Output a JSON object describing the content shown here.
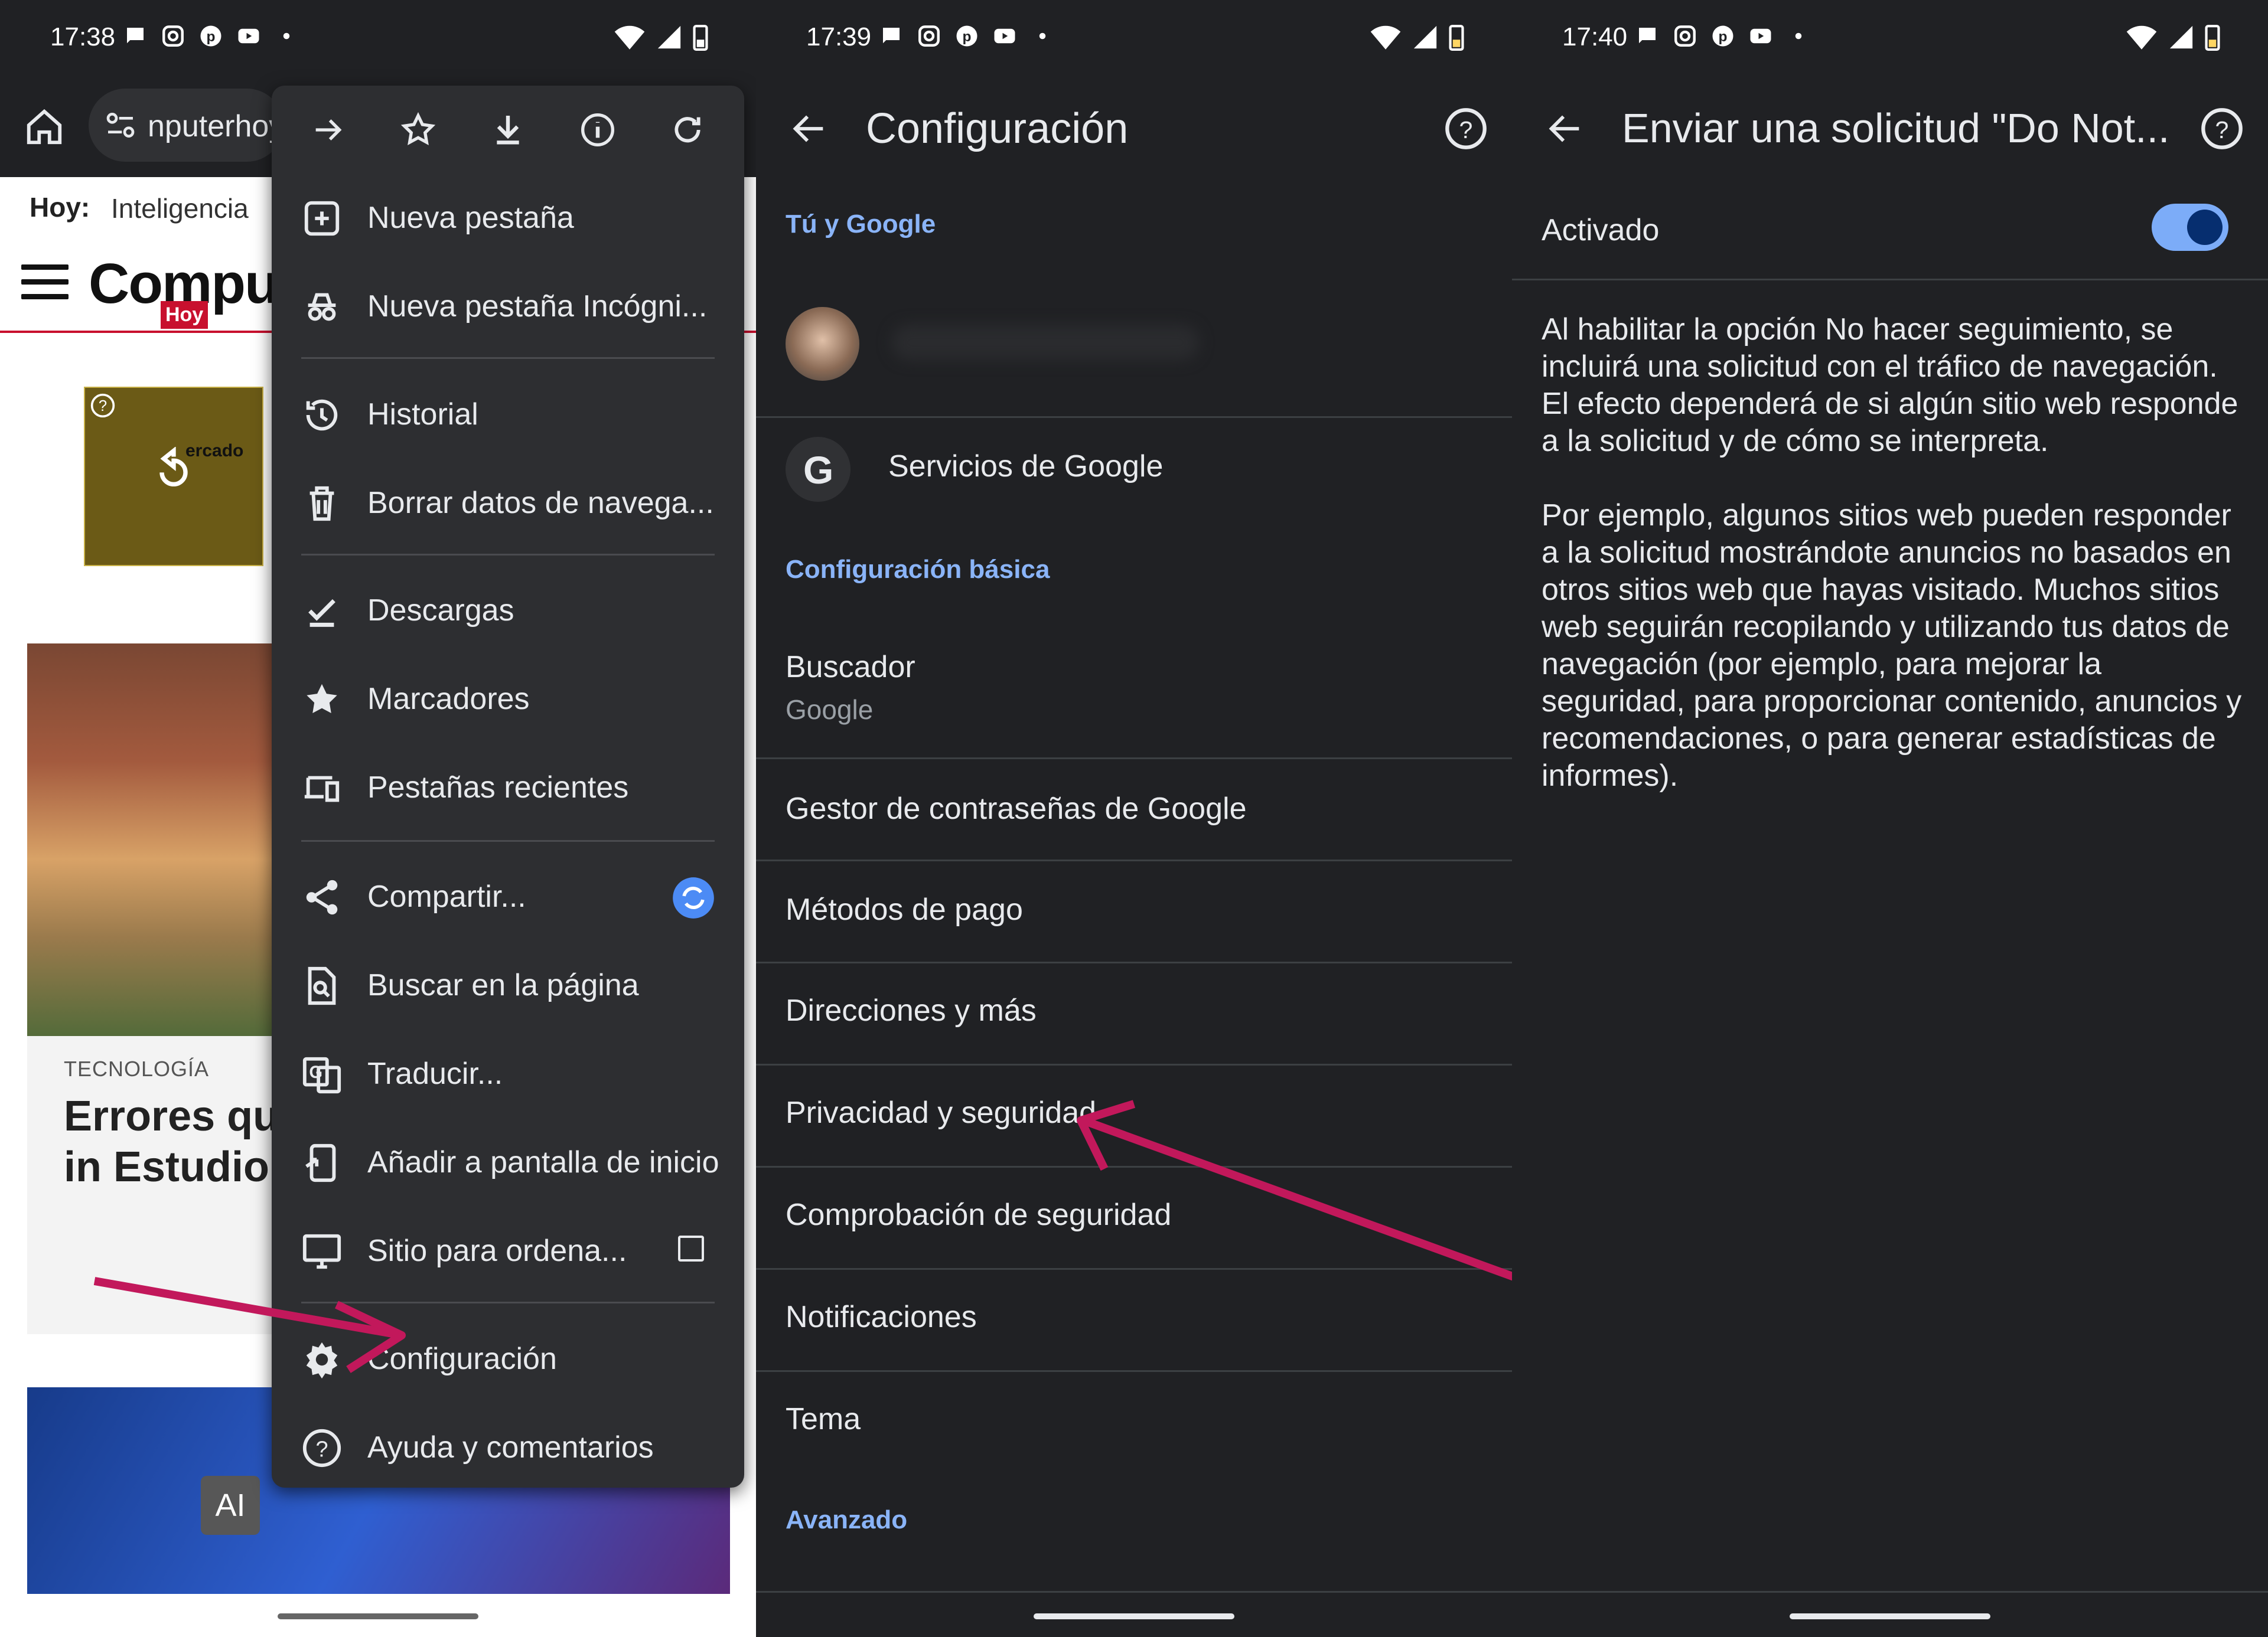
{
  "colors": {
    "background": "#202124",
    "accent_blue": "#8ab4f8",
    "arrow_magenta": "#c2185b",
    "toggle_on": "#7cacf8"
  },
  "panel1": {
    "status": {
      "time": "17:38"
    },
    "url_text": "nputerhoy",
    "ticker": {
      "label": "Hoy:",
      "text": "Inteligencia"
    },
    "logo": {
      "main": "Comput",
      "sub": "Hoy"
    },
    "ad": {
      "text": "ercado"
    },
    "article": {
      "kicker": "TECNOLOGÍA",
      "headline": "Errores qu ChatGPT p mejores in Estudio Gl"
    },
    "ai_badge": "AI",
    "menu": {
      "top_icons": [
        "forward-icon",
        "star-icon",
        "download-icon",
        "info-icon",
        "refresh-icon"
      ],
      "items": [
        {
          "label": "Nueva pestaña",
          "icon": "new-tab-icon"
        },
        {
          "label": "Nueva pestaña Incógni...",
          "icon": "incognito-icon"
        },
        {
          "label": "Historial",
          "icon": "history-icon"
        },
        {
          "label": "Borrar datos de navega...",
          "icon": "trash-icon"
        },
        {
          "label": "Descargas",
          "icon": "downloads-icon"
        },
        {
          "label": "Marcadores",
          "icon": "star-icon"
        },
        {
          "label": "Pestañas recientes",
          "icon": "devices-icon"
        },
        {
          "label": "Compartir...",
          "icon": "share-icon"
        },
        {
          "label": "Buscar en la página",
          "icon": "find-in-page-icon"
        },
        {
          "label": "Traducir...",
          "icon": "translate-icon"
        },
        {
          "label": "Añadir a pantalla de inicio",
          "icon": "add-to-home-icon"
        },
        {
          "label": "Sitio para ordena...",
          "icon": "desktop-icon"
        },
        {
          "label": "Configuración",
          "icon": "gear-icon"
        },
        {
          "label": "Ayuda y comentarios",
          "icon": "help-icon"
        }
      ]
    }
  },
  "panel2": {
    "status": {
      "time": "17:39"
    },
    "title": "Configuración",
    "sections": {
      "you_google": "Tú y Google",
      "basic": "Configuración básica",
      "advanced": "Avanzado"
    },
    "google_services": "Servicios de Google",
    "search_engine": {
      "label": "Buscador",
      "value": "Google"
    },
    "rows": [
      "Gestor de contraseñas de Google",
      "Métodos de pago",
      "Direcciones y más",
      "Privacidad y seguridad",
      "Comprobación de seguridad",
      "Notificaciones",
      "Tema"
    ]
  },
  "panel3": {
    "status": {
      "time": "17:40"
    },
    "title": "Enviar una solicitud \"Do Not...",
    "toggle_label": "Activado",
    "toggle_on": true,
    "paragraph1": "Al habilitar la opción No hacer seguimiento, se incluirá una solicitud con el tráfico de navegación. El efecto dependerá de si algún sitio web responde a la solicitud y de cómo se interpreta.",
    "paragraph2": "Por ejemplo, algunos sitios web pueden responder a la solicitud mostrándote anuncios no basados en otros sitios web que hayas visitado. Muchos sitios web seguirán recopilando y utilizando tus datos de navegación (por ejemplo, para mejorar la seguridad, para proporcionar contenido, anuncios y recomendaciones, o para generar estadísticas de informes)."
  }
}
